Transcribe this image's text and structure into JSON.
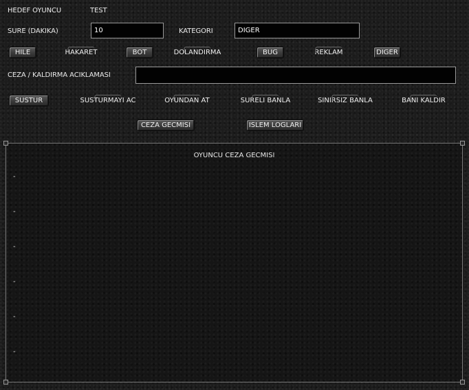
{
  "form": {
    "target_label": "HEDEF OYUNCU",
    "target_value": "TEST",
    "duration_label": "SURE (DAKIKA)",
    "duration_value": "10",
    "category_label": "KATEGORI",
    "category_value": "DIGER",
    "reason_label": "CEZA / KALDIRMA ACIKLAMASI",
    "reason_value": ""
  },
  "categories": [
    "HILE",
    "HAKARET",
    "BOT",
    "DOLANDIRMA",
    "BUG",
    "REKLAM",
    "DIGER"
  ],
  "actions": [
    "SUSTUR",
    "SUSTURMAYI AC",
    "OYUNDAN AT",
    "SURELI BANLA",
    "SINIRSIZ BANLA",
    "BANI KALDIR"
  ],
  "history_buttons": [
    "CEZA GECMISI",
    "ISLEM LOGLARI"
  ],
  "history_panel": {
    "title": "OYUNCU CEZA GECMISI",
    "entries": [
      "-",
      "-",
      "-",
      "-",
      "-",
      "-"
    ]
  }
}
